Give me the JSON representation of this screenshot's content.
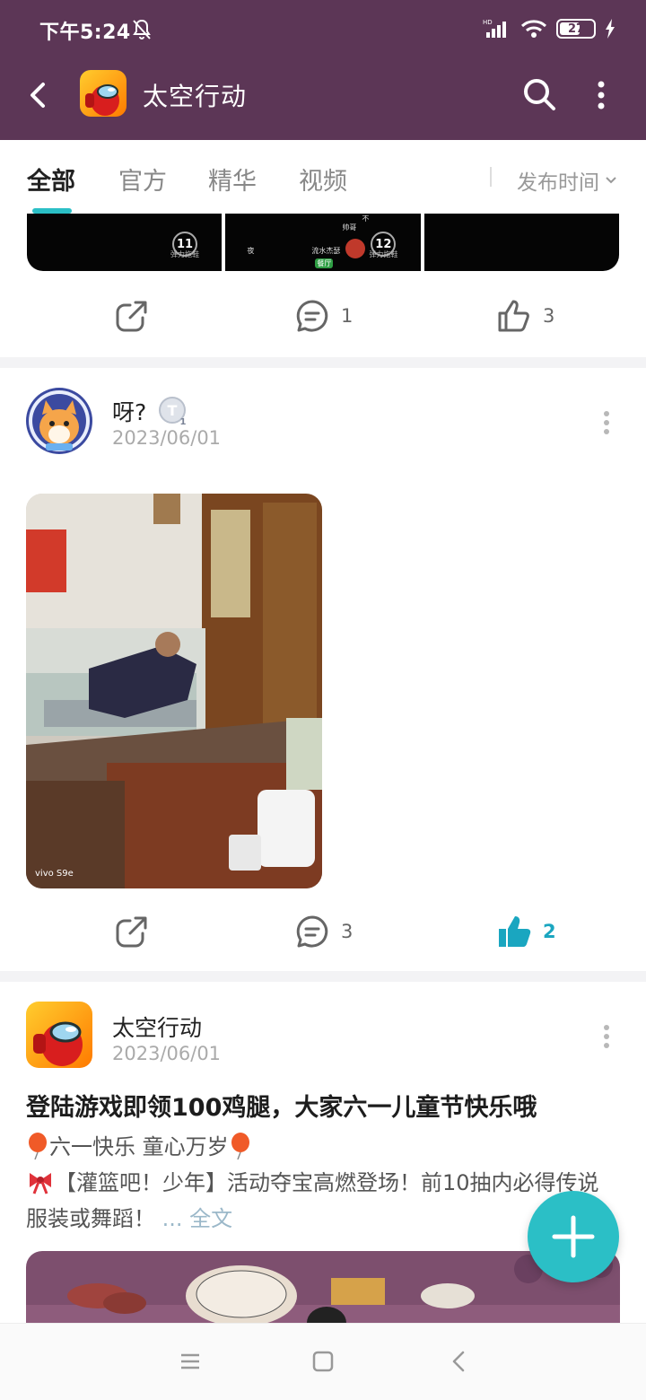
{
  "status_bar": {
    "time": "下午5:24",
    "battery_level": "27"
  },
  "app_bar": {
    "title": "太空行动"
  },
  "tabs": {
    "items": [
      {
        "label": "全部",
        "active": true
      },
      {
        "label": "官方",
        "active": false
      },
      {
        "label": "精华",
        "active": false
      },
      {
        "label": "视频",
        "active": false
      }
    ],
    "sort_label": "发布时间"
  },
  "feed": {
    "post0": {
      "thumb_labels": [
        "11",
        "12"
      ],
      "thumb_captions": [
        "弹力拖鞋",
        "弹力拖鞋"
      ],
      "scene_labels": [
        "夜",
        "流水杰瑟",
        "餐厅",
        "帅哥",
        "不"
      ],
      "comments": "1",
      "likes": "3"
    },
    "post1": {
      "author": "呀?",
      "level_badge": "T",
      "level_num": "1",
      "date": "2023/06/01",
      "photo_watermark": "vivo S9e",
      "comments": "3",
      "likes": "2",
      "liked": true
    },
    "post2": {
      "author": "太空行动",
      "date": "2023/06/01",
      "title": "登陆游戏即领100鸡腿，大家六一儿童节快乐哦",
      "line1": "六一快乐 童心万岁",
      "line2": "【灌篮吧！少年】活动夺宝高燃登场！前10抽内必得传说",
      "line3": "服装或舞蹈！",
      "read_more": "... 全文"
    }
  },
  "colors": {
    "header_bg": "#5c3656",
    "accent": "#2bbfc6",
    "liked": "#1aa6c0"
  }
}
